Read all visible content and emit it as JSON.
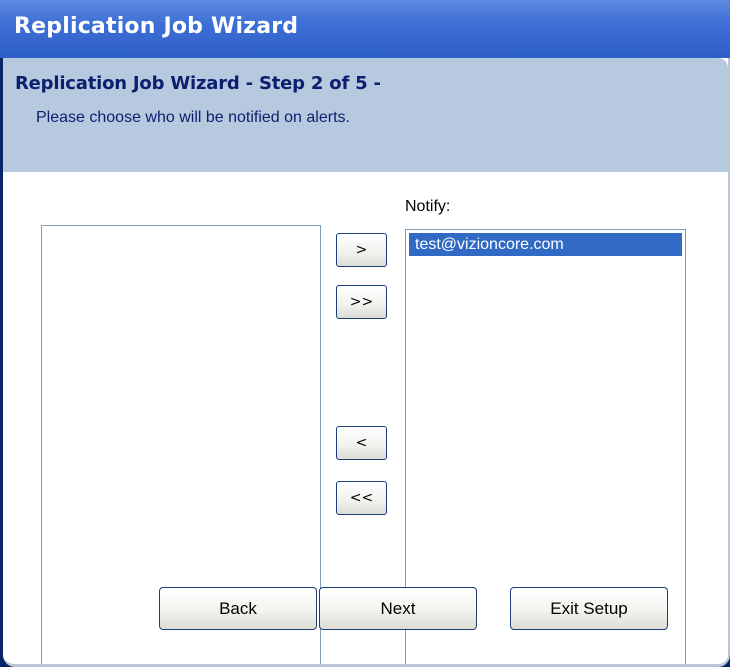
{
  "window": {
    "title": "Replication Job Wizard"
  },
  "header": {
    "step_title": "Replication Job Wizard - Step 2 of 5 -",
    "description": "Please choose who will be notified on alerts."
  },
  "available_list": {
    "items": []
  },
  "notify_list": {
    "label": "Notify:",
    "items": [
      {
        "text": "test@vizioncore.com",
        "selected": true
      }
    ]
  },
  "move_buttons": {
    "add_label": ">",
    "add_all_label": ">>",
    "remove_label": "<",
    "remove_all_label": "<<"
  },
  "footer": {
    "back_label": "Back",
    "next_label": "Next",
    "exit_label": "Exit Setup"
  },
  "colors": {
    "title_bar": "#3d6fd6",
    "header_band": "#b7c9df",
    "selection": "#316ac5",
    "header_text": "#0b1f6e"
  }
}
